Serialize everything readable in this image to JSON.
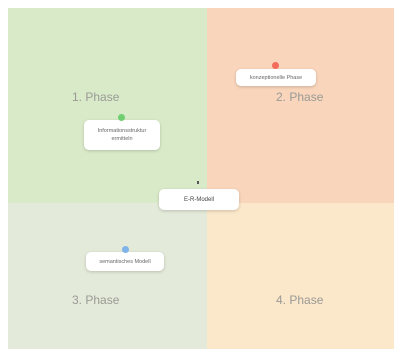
{
  "phases": [
    {
      "label": "1. Phase"
    },
    {
      "label": "2. Phase"
    },
    {
      "label": "3. Phase"
    },
    {
      "label": "4. Phase"
    }
  ],
  "cards": {
    "informationsstruktur": {
      "line1": "Informationsstruktur",
      "line2": "ermitteln",
      "dot_color": "#6fcf70"
    },
    "konzeptionell": {
      "label": "konzeptionelle Phase",
      "dot_color": "#f26b5b"
    },
    "er_modell": {
      "label": "E-R-Modell"
    },
    "semantisch": {
      "label": "semantisches Modell",
      "dot_color": "#7fb3ea"
    }
  },
  "colors": {
    "quadrant_1": "#d9eac9",
    "quadrant_2": "#f8d5bb",
    "quadrant_3": "#e3ead9",
    "quadrant_4": "#fbe7c9"
  }
}
